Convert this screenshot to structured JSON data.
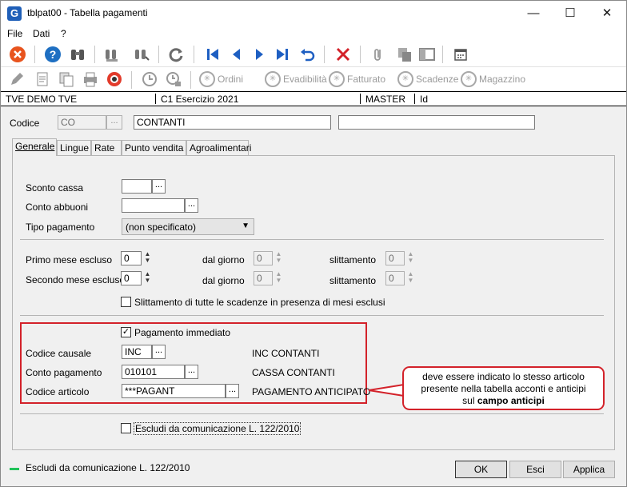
{
  "window": {
    "title": "tblpat00 - Tabella pagamenti",
    "app_icon": "G"
  },
  "menu": {
    "file": "File",
    "dati": "Dati",
    "help": "?"
  },
  "toolbar2": {
    "ordini": "Ordini",
    "evadibilita": "Evadibilità",
    "fatturato": "Fatturato",
    "scadenze": "Scadenze",
    "magazzino": "Magazzino"
  },
  "infobar": {
    "company": "TVE DEMO TVE",
    "exercise": "C1 Esercizio 2021",
    "user": "MASTER",
    "id": "Id"
  },
  "header": {
    "codice_label": "Codice",
    "codice_value": "CO",
    "descrizione": "CONTANTI",
    "extra": ""
  },
  "tabs": [
    "Generale",
    "Lingue",
    "Rate",
    "Punto vendita",
    "Agroalimentari"
  ],
  "form": {
    "sconto_cassa_label": "Sconto cassa",
    "sconto_cassa_value": "",
    "conto_abbuoni_label": "Conto abbuoni",
    "conto_abbuoni_value": "",
    "tipo_pagamento_label": "Tipo pagamento",
    "tipo_pagamento_value": "(non specificato)",
    "primo_mese_label": "Primo mese escluso",
    "primo_mese_value": "0",
    "secondo_mese_label": "Secondo mese escluso",
    "secondo_mese_value": "0",
    "dal_giorno_label": "dal giorno",
    "dal_giorno_1": "0",
    "dal_giorno_2": "0",
    "slittamento_label": "slittamento",
    "slittamento_1": "0",
    "slittamento_2": "0",
    "slittamento_chk_label": "Slittamento di tutte le scadenze in presenza di mesi esclusi",
    "pagamento_immediato_label": "Pagamento immediato",
    "codice_causale_label": "Codice causale",
    "codice_causale_value": "INC",
    "codice_causale_desc": "INC CONTANTI",
    "conto_pagamento_label": "Conto pagamento",
    "conto_pagamento_value": "010101",
    "conto_pagamento_desc": "CASSA CONTANTI",
    "codice_articolo_label": "Codice articolo",
    "codice_articolo_value": "***PAGANT",
    "codice_articolo_desc": "PAGAMENTO ANTICIPATO",
    "escludi_label": "Escludi da comunicazione L. 122/2010"
  },
  "callout": {
    "line1": "deve essere indicato lo stesso articolo",
    "line2": "presente nella tabella acconti e anticipi",
    "line3_prefix": "sul ",
    "line3_bold": "campo anticipi"
  },
  "status": {
    "text": "Escludi da comunicazione L. 122/2010",
    "indicator_color": "#22c35a"
  },
  "buttons": {
    "ok": "OK",
    "esci": "Esci",
    "applica": "Applica"
  },
  "colors": {
    "accent_red": "#d3222a",
    "nav_blue": "#1e5fc2"
  }
}
